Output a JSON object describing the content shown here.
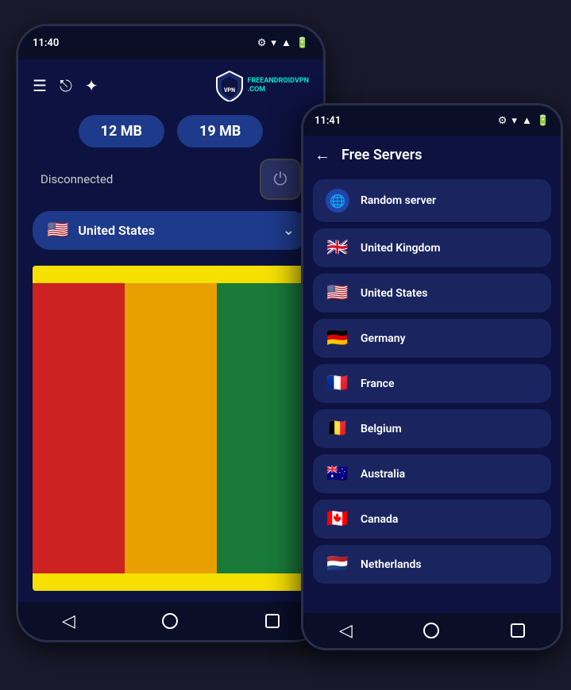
{
  "phone1": {
    "status_time": "11:40",
    "stats": {
      "download": "12 MB",
      "upload": "19 MB"
    },
    "disconnect_label": "Disconnected",
    "selected_country": "United States",
    "selected_flag": "🇺🇸",
    "logo": {
      "brand": "FREE",
      "brand2": "ANDROIDVPN",
      "suffix": ".COM"
    }
  },
  "phone2": {
    "status_time": "11:41",
    "header_title": "Free Servers",
    "servers": [
      {
        "name": "Random server",
        "flag": "🌐",
        "type": "globe"
      },
      {
        "name": "United Kingdom",
        "flag": "🇬🇧",
        "type": "flag"
      },
      {
        "name": "United States",
        "flag": "🇺🇸",
        "type": "flag"
      },
      {
        "name": "Germany",
        "flag": "🇩🇪",
        "type": "flag"
      },
      {
        "name": "France",
        "flag": "🇫🇷",
        "type": "flag"
      },
      {
        "name": "Belgium",
        "flag": "🇧🇪",
        "type": "flag"
      },
      {
        "name": "Australia",
        "flag": "🇦🇺",
        "type": "flag"
      },
      {
        "name": "Canada",
        "flag": "🇨🇦",
        "type": "flag"
      },
      {
        "name": "Netherlands",
        "flag": "🇳🇱",
        "type": "flag"
      }
    ]
  }
}
